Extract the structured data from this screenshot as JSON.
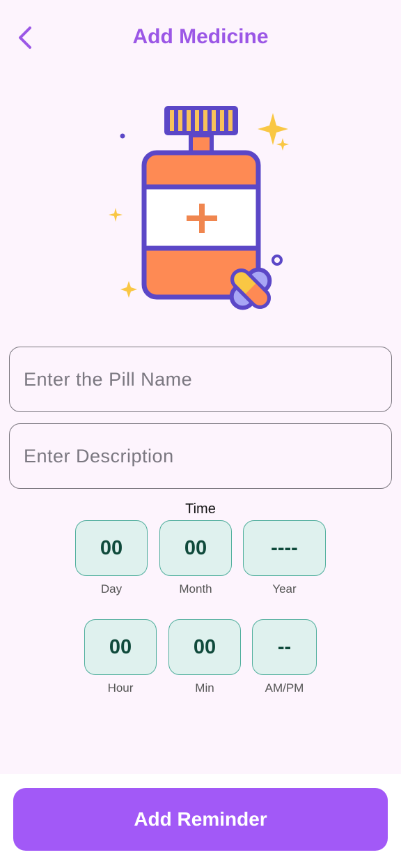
{
  "header": {
    "title": "Add Medicine",
    "back_icon": "chevron-left-icon"
  },
  "illustration": {
    "name": "medicine-bottle-illustration",
    "colors": {
      "outline": "#5b47c7",
      "bottle": "#fe8a54",
      "cap_stripes": "#f8c25a",
      "sparkle": "#f9c744",
      "cross": "#f0864f"
    }
  },
  "form": {
    "pill_name": {
      "value": "",
      "placeholder": "Enter the Pill Name"
    },
    "description": {
      "value": "",
      "placeholder": "Enter Description"
    }
  },
  "time": {
    "label": "Time",
    "date_fields": [
      {
        "value": "00",
        "label": "Day"
      },
      {
        "value": "00",
        "label": "Month"
      },
      {
        "value": "----",
        "label": "Year"
      }
    ],
    "clock_fields": [
      {
        "value": "00",
        "label": "Hour"
      },
      {
        "value": "00",
        "label": "Min"
      },
      {
        "value": "--",
        "label": "AM/PM"
      }
    ]
  },
  "actions": {
    "add_reminder_label": "Add Reminder"
  },
  "colors": {
    "accent": "#a259f7",
    "title": "#9b57e6",
    "box_bg": "#dff1ee",
    "box_border": "#4fae9c",
    "box_text": "#0f4a3b",
    "background": "#fdf4fd"
  }
}
